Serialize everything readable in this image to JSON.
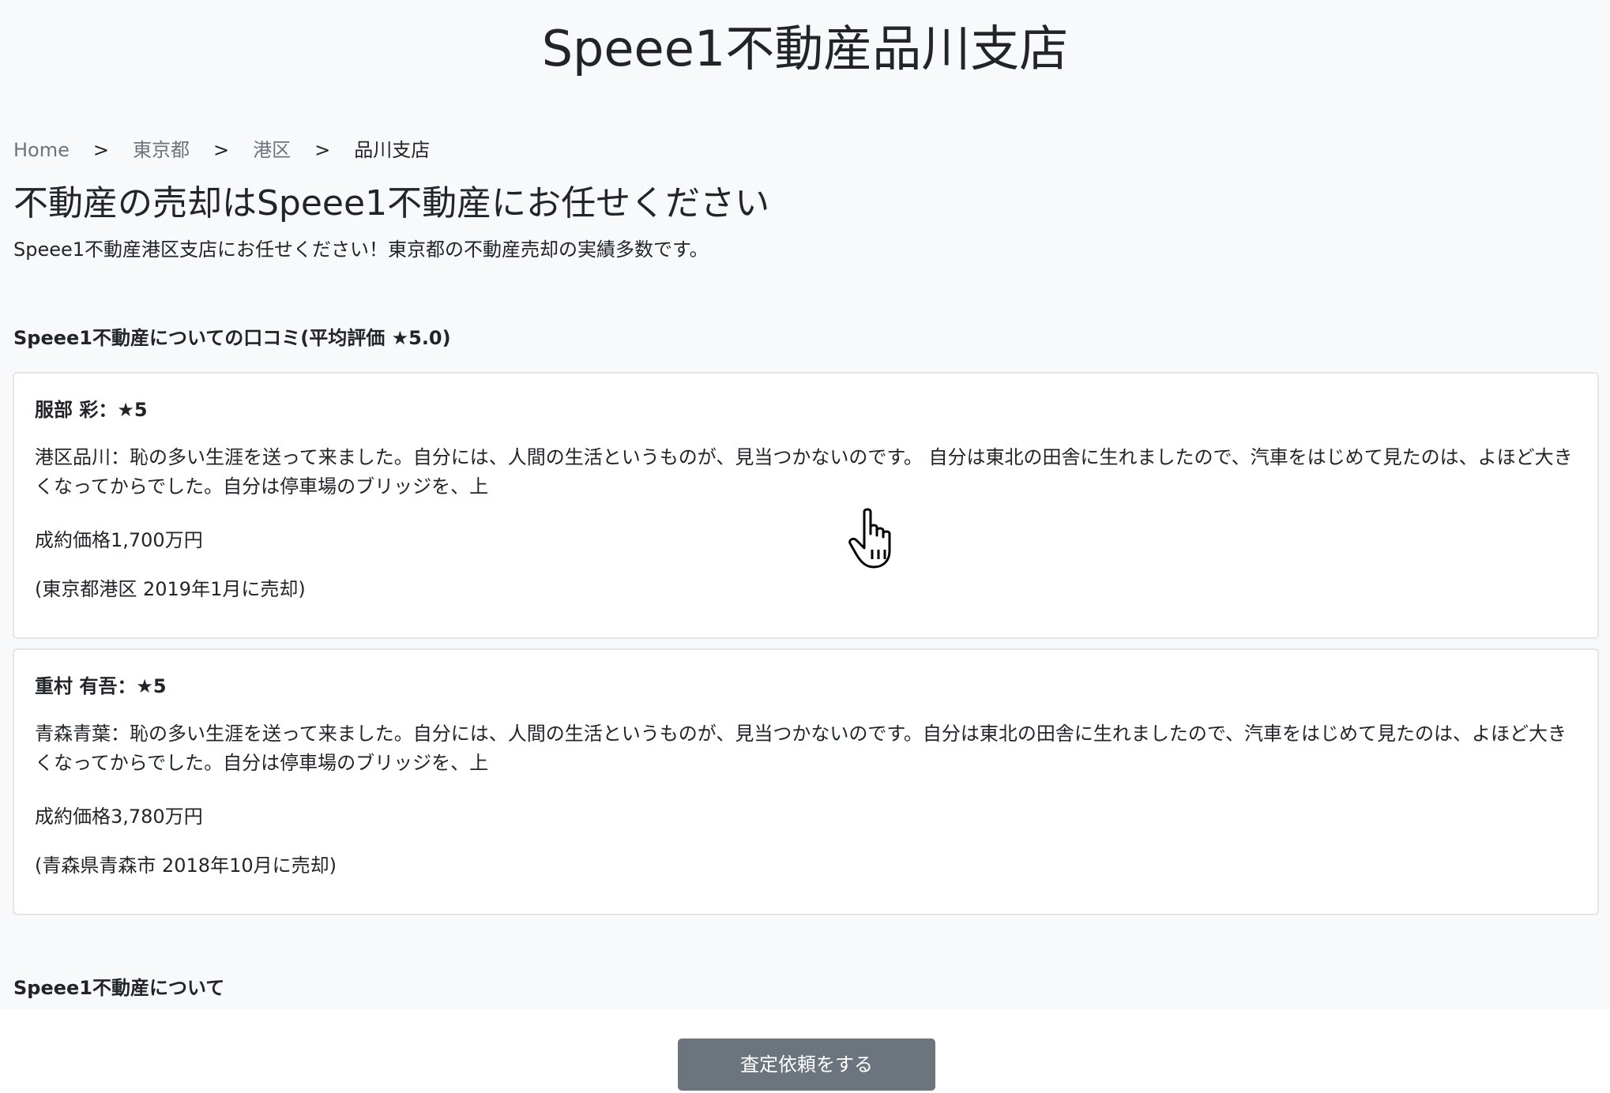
{
  "header": {
    "title": "Speee1不動産品川支店"
  },
  "breadcrumb": {
    "items": [
      "Home",
      "東京都",
      "港区"
    ],
    "separator": ">",
    "current": "品川支店"
  },
  "intro": {
    "heading": "不動産の売却はSpeee1不動産にお任せください",
    "lead": "Speee1不動産港区支店にお任せください！東京都の不動産売却の実績多数です。"
  },
  "reviews": {
    "heading": "Speee1不動産についての口コミ(平均評価 ★5.0)",
    "items": [
      {
        "reviewer": "服部 彩：★5",
        "body": "港区品川：恥の多い生涯を送って来ました。自分には、人間の生活というものが、見当つかないのです。 自分は東北の田舎に生れましたので、汽車をはじめて見たのは、よほど大きくなってからでした。自分は停車場のブリッジを、上",
        "price": "成約価格1,700万円",
        "meta": "(東京都港区 2019年1月に売却)"
      },
      {
        "reviewer": "重村 有吾：★5",
        "body": "青森青葉：恥の多い生涯を送って来ました。自分には、人間の生活というものが、見当つかないのです。自分は東北の田舎に生れましたので、汽車をはじめて見たのは、よほど大きくなってからでした。自分は停車場のブリッジを、上",
        "price": "成約価格3,780万円",
        "meta": "(青森県青森市 2018年10月に売却)"
      }
    ]
  },
  "about": {
    "heading": "Speee1不動産について"
  },
  "cta": {
    "label": "査定依頼をする"
  },
  "icons": {
    "cursor": "hand-pointer-icon"
  },
  "colors": {
    "background": "#f8f9fa",
    "button": "#6c757d",
    "link": "#6c757d"
  }
}
